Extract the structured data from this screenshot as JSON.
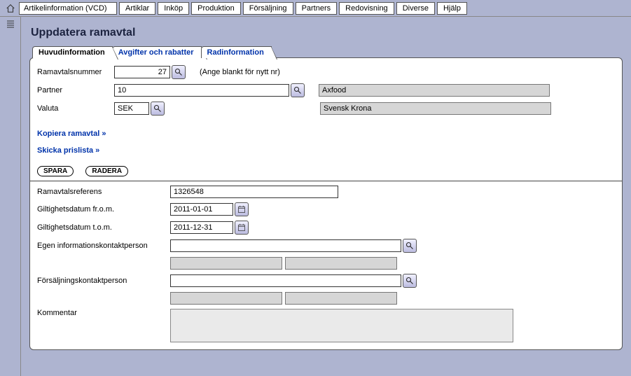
{
  "menu": {
    "items": [
      "Artikelinformation (VCD)",
      "Artiklar",
      "Inköp",
      "Produktion",
      "Försäljning",
      "Partners",
      "Redovisning",
      "Diverse",
      "Hjälp"
    ]
  },
  "page": {
    "title": "Uppdatera ramavtal"
  },
  "tabs": {
    "t1": "Huvudinformation",
    "t2": "Avgifter och rabatter",
    "t3": "Radinformation"
  },
  "form": {
    "ramavtalsnummer_label": "Ramavtalsnummer",
    "ramavtalsnummer_value": "27",
    "ramavtalsnummer_note": "(Ange blankt för nytt nr)",
    "partner_label": "Partner",
    "partner_value": "10",
    "partner_name": "Axfood",
    "valuta_label": "Valuta",
    "valuta_value": "SEK",
    "valuta_name": "Svensk Krona"
  },
  "links": {
    "kopiera": "Kopiera ramavtal »",
    "skicka": "Skicka prislista »"
  },
  "buttons": {
    "spara": "SPARA",
    "radera": "RADERA"
  },
  "details": {
    "ref_label": "Ramavtalsreferens",
    "ref_value": "1326548",
    "from_label": "Giltighetsdatum fr.o.m.",
    "from_value": "2011-01-01",
    "to_label": "Giltighetsdatum t.o.m.",
    "to_value": "2011-12-31",
    "egen_label": "Egen informationskontaktperson",
    "fors_label": "Försäljningskontaktperson",
    "kommentar_label": "Kommentar",
    "kommentar_value": ""
  }
}
